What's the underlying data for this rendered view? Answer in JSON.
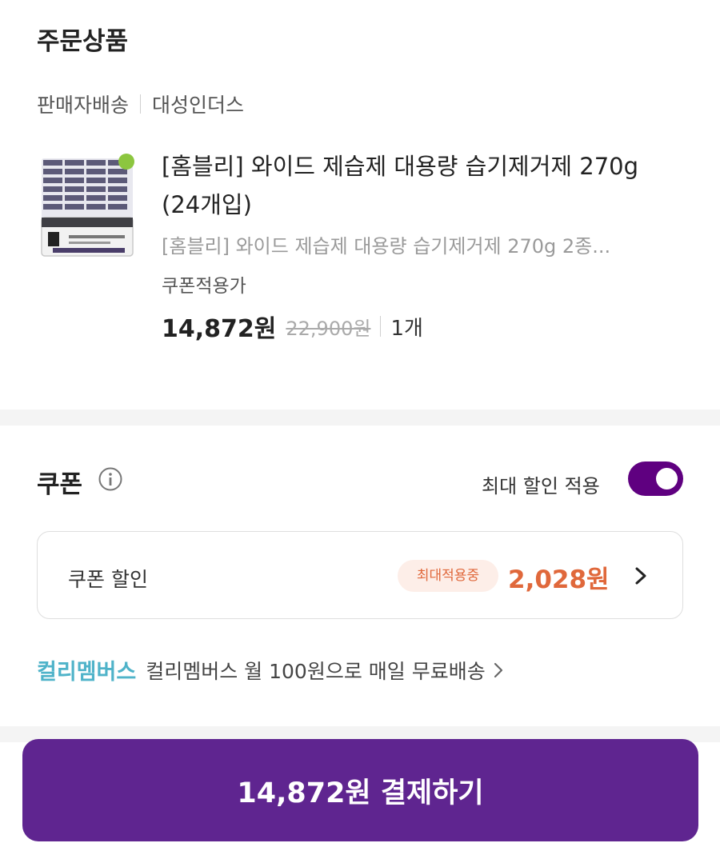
{
  "order": {
    "title": "주문상품",
    "shipping_type": "판매자배송",
    "seller_name": "대성인더스"
  },
  "product": {
    "image_icon": "dehumidifier-product-image",
    "name": "[홈블리] 와이드 제습제 대용량 습기제거제 270g (24개입)",
    "option": "[홈블리] 와이드 제습제 대용량 습기제거제 270g 2종...",
    "coupon_applicable": "쿠폰적용가",
    "sale_price": "14,872원",
    "original_price": "22,900원",
    "quantity": "1개"
  },
  "coupon": {
    "title": "쿠폰",
    "info_icon": "info-icon",
    "max_discount_label": "최대 할인 적용",
    "max_discount_enabled": true,
    "box_label": "쿠폰 할인",
    "applied_badge": "최대적용중",
    "amount": "2,028원"
  },
  "kurly_members": {
    "brand": "컬리멤버스",
    "text": "컬리멤버스 월 100원으로 매일 무료배송"
  },
  "checkout": {
    "button_label": "14,872원 결제하기"
  },
  "colors": {
    "accent_purple": "#5f0080",
    "pay_button": "#5f2590",
    "discount_orange": "#e0683b",
    "kurly_teal": "#4fb3c9"
  }
}
